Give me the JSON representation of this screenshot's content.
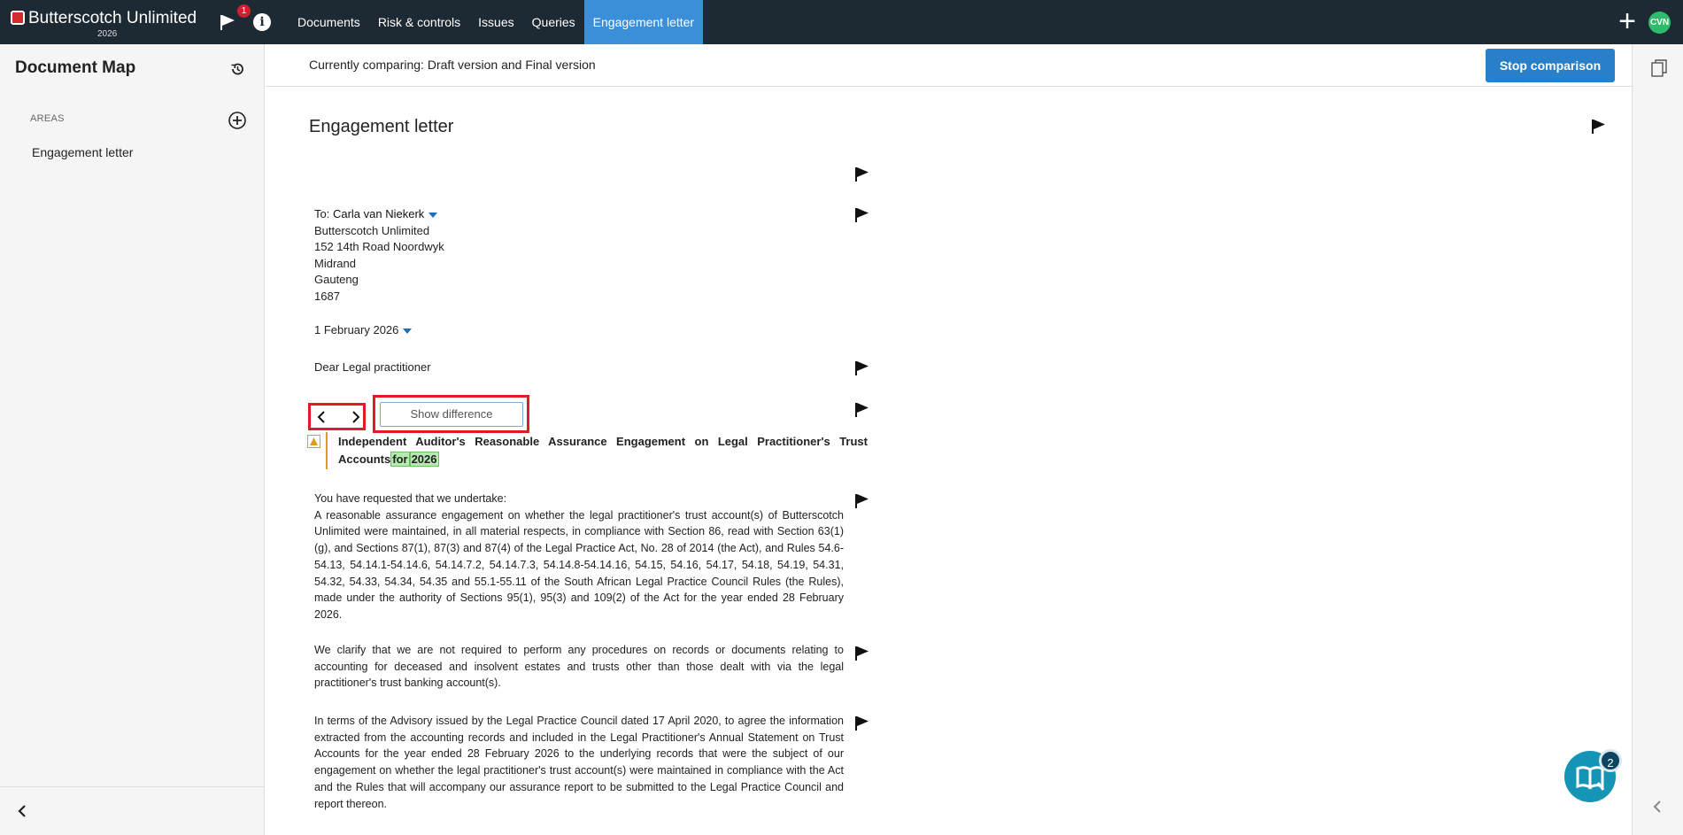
{
  "app": {
    "brand_name": "Butterscotch Unlimited",
    "brand_year": "2026",
    "notification_count": "1",
    "avatar_initials": "CVN",
    "accent_color": "#3b8ed8"
  },
  "nav": {
    "items": [
      "Documents",
      "Risk & controls",
      "Issues",
      "Queries",
      "Engagement letter"
    ],
    "active": "Engagement letter"
  },
  "sidebar": {
    "title": "Document Map",
    "areas_label": "AREAS",
    "items": [
      "Engagement letter"
    ]
  },
  "compare": {
    "text": "Currently comparing: Draft version and Final version",
    "stop_label": "Stop comparison"
  },
  "document": {
    "title": "Engagement letter",
    "to_label": "To:",
    "to_name": "Carla van Niekerk",
    "address": [
      "Butterscotch Unlimited",
      "152 14th Road Noordwyk",
      "Midrand",
      "Gauteng",
      "1687"
    ],
    "date": "1 February 2026",
    "salutation": "Dear Legal practitioner",
    "show_difference_label": "Show difference",
    "heading_text": "Independent Auditor's Reasonable Assurance Engagement on Legal Practitioner's Trust Accounts",
    "heading_ins_1": "for",
    "heading_ins_2": "2026",
    "para1_intro": "You have requested that we undertake:",
    "para1_body": "A reasonable assurance engagement on whether the legal practitioner's trust account(s) of Butterscotch Unlimited were maintained, in all material respects, in compliance with Section 86, read with Section 63(1)(g), and Sections 87(1), 87(3) and 87(4) of the Legal Practice Act, No. 28 of 2014 (the Act), and Rules 54.6-54.13, 54.14.1-54.14.6, 54.14.7.2, 54.14.7.3, 54.14.8-54.14.16, 54.15, 54.16, 54.17, 54.18, 54.19, 54.31, 54.32, 54.33, 54.34, 54.35 and 55.1-55.11 of the South African Legal Practice Council Rules (the Rules), made under the authority of Sections 95(1), 95(3) and 109(2) of the Act for the year ended 28 February 2026.",
    "para2": "We clarify that we are not required to perform any procedures on records or documents relating to accounting for deceased and insolvent estates and trusts other than those dealt with via the legal practitioner's trust banking account(s).",
    "para3": "In terms of the Advisory issued by the Legal Practice Council dated 17 April 2020, to agree the information extracted from the accounting records and included in the Legal Practitioner's Annual Statement on Trust Accounts for the year ended 28 February 2026 to the underlying records that were the subject of our engagement on whether the legal practitioner's trust account(s) were maintained in compliance with the Act and the Rules that will accompany our assurance report to be submitted to the Legal Practice Council and report thereon."
  },
  "chat": {
    "badge_count": "2"
  }
}
